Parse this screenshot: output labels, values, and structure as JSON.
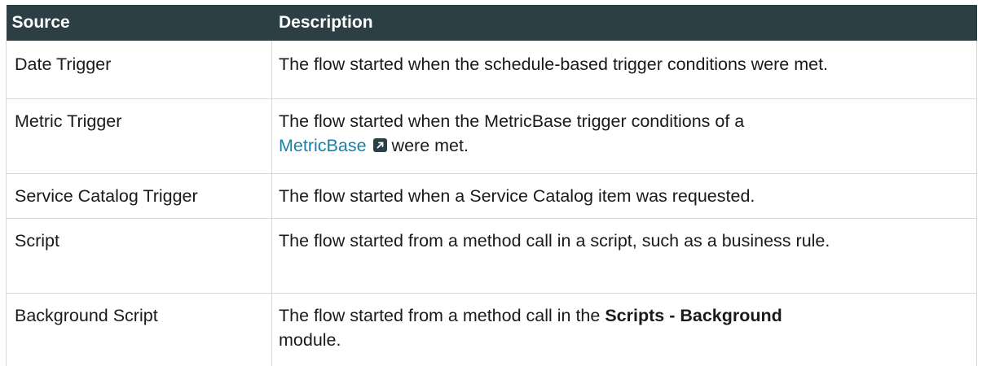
{
  "table": {
    "headers": {
      "source": "Source",
      "description": "Description"
    },
    "rows": [
      {
        "source": "Date Trigger",
        "description": "The flow started when the schedule-based trigger conditions were met."
      },
      {
        "source": "Metric Trigger",
        "description_pre": "The flow started when the MetricBase trigger conditions of a",
        "link_text": "MetricBase",
        "link_icon": "external-link-icon",
        "description_post": "were met."
      },
      {
        "source": "Service Catalog Trigger",
        "description": "The flow started when a Service Catalog item was requested."
      },
      {
        "source": "Script",
        "description": "The flow started from a method call in a script, such as a business rule."
      },
      {
        "source": "Background Script",
        "description_pre": "The flow started from a method call in the",
        "bold_text": "Scripts - Background",
        "description_post": "module."
      }
    ]
  },
  "colors": {
    "header_bg": "#2b3f44",
    "link": "#1a7fa8",
    "border": "#d8d8d8"
  }
}
